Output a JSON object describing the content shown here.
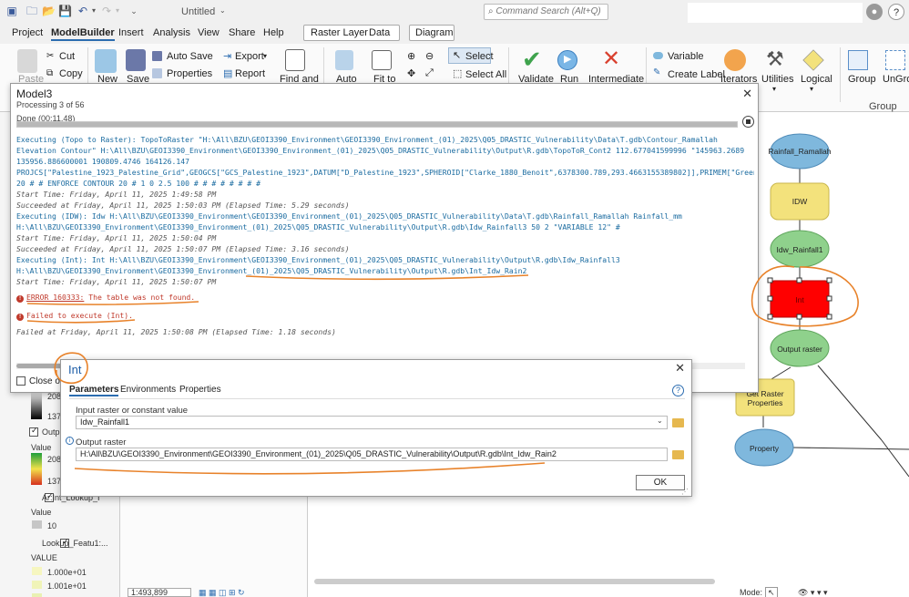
{
  "titlebar": {
    "doc_title": "Untitled",
    "search_placeholder": "Command Search (Alt+Q)",
    "user_icon": "user-icon",
    "help_label": "?"
  },
  "menu": {
    "items": [
      "Project",
      "ModelBuilder",
      "Insert",
      "Analysis",
      "View",
      "Share",
      "Help"
    ],
    "active": "ModelBuilder",
    "contextual": [
      "Raster Layer",
      "Data",
      "Diagram"
    ]
  },
  "ribbon": {
    "paste": "Paste",
    "cut": "Cut",
    "copy": "Copy",
    "new": "New",
    "save": "Save",
    "auto_save": "Auto Save",
    "properties": "Properties",
    "export": "Export",
    "report": "Report",
    "find_and": "Find and",
    "auto": "Auto",
    "fit_to": "Fit to",
    "select": "Select",
    "select_all": "Select All",
    "validate": "Validate",
    "run": "Run",
    "intermediate": "Intermediate",
    "variable": "Variable",
    "create_label": "Create Label",
    "iterators": "Iterators",
    "utilities": "Utilities",
    "logical": "Logical",
    "group": "Group",
    "ungroup": "UnGrou",
    "group_section": "Group"
  },
  "model3": {
    "title": "Model3",
    "processing": "Processing 3 of 56",
    "done": "Done (00:11.48)",
    "progress_fraction": 1.0,
    "log": [
      {
        "type": "exec",
        "text": "Executing (Topo to Raster): TopoToRaster \"H:\\All\\BZU\\GEOI3390_Environment\\GEOI3390_Environment_(01)_2025\\Q05_DRASTIC_Vulnerability\\Data\\T.gdb\\Contour_Ramallah"
      },
      {
        "type": "exec",
        "text": "Elevation Contour\" H:\\All\\BZU\\GEOI3390_Environment\\GEOI3390_Environment_(01)_2025\\Q05_DRASTIC_Vulnerability\\Output\\R.gdb\\TopoToR_Cont2 112.677041599996 \"145963.2689"
      },
      {
        "type": "exec",
        "text": "135956.886600001 190809.4746 164126.147"
      },
      {
        "type": "exec",
        "text": "PROJCS[\"Palestine_1923_Palestine_Grid\",GEOGCS[\"GCS_Palestine_1923\",DATUM[\"D_Palestine_1923\",SPHEROID[\"Clarke_1880_Benoit\",6378300.789,293.4663155389802]],PRIMEM[\"Greenw"
      },
      {
        "type": "exec",
        "text": "20 # # ENFORCE CONTOUR 20 # 1 0 2.5 100 # # # # # # # #"
      },
      {
        "type": "info",
        "text": "Start Time: Friday, April 11, 2025 1:49:58 PM"
      },
      {
        "type": "info",
        "text": "Succeeded at Friday, April 11, 2025 1:50:03 PM (Elapsed Time: 5.29 seconds)"
      },
      {
        "type": "exec",
        "text": "Executing (IDW): Idw H:\\All\\BZU\\GEOI3390_Environment\\GEOI3390_Environment_(01)_2025\\Q05_DRASTIC_Vulnerability\\Data\\T.gdb\\Rainfall_Ramallah Rainfall_mm"
      },
      {
        "type": "exec",
        "text": "H:\\All\\BZU\\GEOI3390_Environment\\GEOI3390_Environment_(01)_2025\\Q05_DRASTIC_Vulnerability\\Output\\R.gdb\\Idw_Rainfall3 50 2 \"VARIABLE 12\" #"
      },
      {
        "type": "info",
        "text": "Start Time: Friday, April 11, 2025 1:50:04 PM"
      },
      {
        "type": "info",
        "text": "Succeeded at Friday, April 11, 2025 1:50:07 PM (Elapsed Time: 3.16 seconds)"
      },
      {
        "type": "exec",
        "text": "Executing (Int): Int H:\\All\\BZU\\GEOI3390_Environment\\GEOI3390_Environment_(01)_2025\\Q05_DRASTIC_Vulnerability\\Output\\R.gdb\\Idw_Rainfall3"
      },
      {
        "type": "exec",
        "text": "H:\\All\\BZU\\GEOI3390_Environment\\GEOI3390_Environment_(01)_2025\\Q05_DRASTIC_Vulnerability\\Output\\R.gdb\\Int_Idw_Rain2"
      },
      {
        "type": "info",
        "text": "Start Time: Friday, April 11, 2025 1:50:07 PM"
      }
    ],
    "error_code": "ERROR 160333:",
    "error_msg": "The table was not found.",
    "failed_exec": "Failed to execute (Int).",
    "failed_at": "Failed at Friday, April 11, 2025 1:50:08 PM (Elapsed Time: 1.18 seconds)",
    "close_on_completion": "Close on"
  },
  "int_dialog": {
    "title": "Int",
    "tabs": [
      "Parameters",
      "Environments",
      "Properties"
    ],
    "input_label": "Input raster or constant value",
    "input_value": "Idw_Rainfall1",
    "output_label": "Output raster",
    "output_value": "H:\\All\\BZU\\GEOI3390_Environment\\GEOI3390_Environment_(01)_2025\\Q05_DRASTIC_Vulnerability\\Output\\R.gdb\\Int_Idw_Rain2",
    "ok": "OK"
  },
  "diagram": {
    "rainfall": "Rainfall_Ramallah",
    "idw": "IDW",
    "idw_out": "Idw_Rainfall1",
    "int_tool": "Int",
    "output_raster": "Output raster",
    "get_raster_props": "Get Raster Properties",
    "property": "Property"
  },
  "toc": {
    "values_a": [
      "208",
      "137"
    ],
    "layer_output": "Outpu",
    "value_label": "Value",
    "values_b": [
      "208",
      "137"
    ],
    "layer_lookup": "Ar:Int_Lookup_I",
    "value_label2": "Value",
    "value_10": "10",
    "layer_featu": "Lookup_Featu1:...",
    "value_label3": "VALUE",
    "values_c": [
      "1.000e+01",
      "1.001e+01",
      "1.001e+01"
    ]
  },
  "status": {
    "scale": "1:493,899",
    "mode": "Mode:"
  },
  "colors": {
    "accent": "#2b6cb0",
    "error": "#c0392b",
    "exec": "#1a6ba0",
    "annotation": "#e8822a",
    "data_node": "#7fb8dd",
    "tool_node": "#f3e27c",
    "output_node": "#8fd18c",
    "failed_node": "#ff0000"
  }
}
